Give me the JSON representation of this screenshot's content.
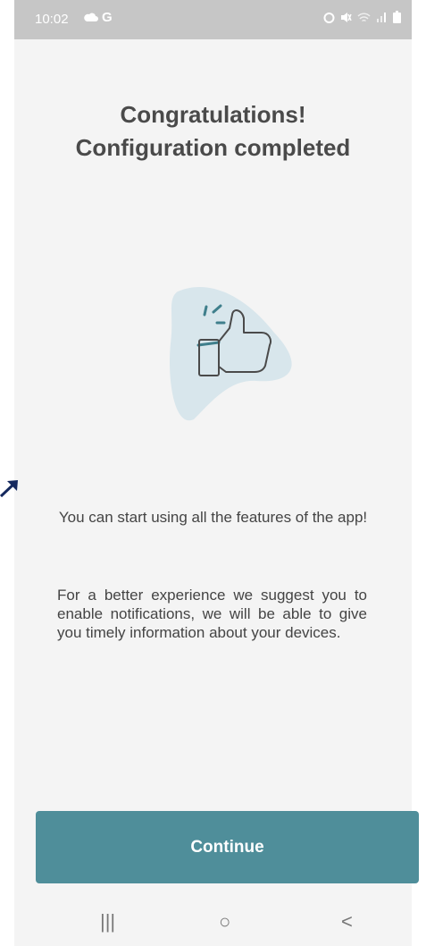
{
  "status_bar": {
    "time": "10:02",
    "g_label": "G"
  },
  "header": {
    "title_line1": "Congratulations!",
    "title_line2": "Configuration completed"
  },
  "body": {
    "message_primary": "You can start using all the features of the app!",
    "message_secondary": "For a better experience we suggest you to enable notifications, we will be able to give you timely information about your devices."
  },
  "actions": {
    "continue_label": "Continue"
  },
  "nav_bar": {
    "recents_glyph": "|||",
    "home_glyph": "○",
    "back_glyph": "<"
  },
  "icons": {
    "illustration": "thumbs-up-icon",
    "status": [
      "cloud-icon",
      "alarm-icon",
      "mute-icon",
      "wifi-icon",
      "signal-icon",
      "battery-icon"
    ]
  },
  "colors": {
    "accent": "#4f8e9a",
    "illustration_bg": "#d8e6ec",
    "status_bar": "#c6c6c6"
  }
}
